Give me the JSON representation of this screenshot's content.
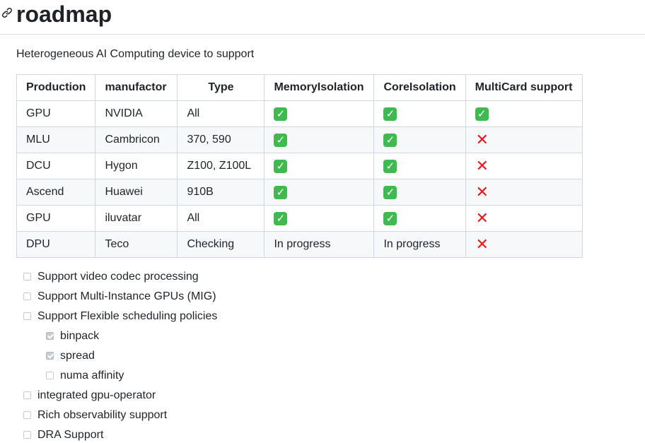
{
  "heading": {
    "title": "roadmap",
    "anchor_icon": "link-icon"
  },
  "intro": "Heterogeneous AI Computing device to support",
  "table": {
    "headers": [
      "Production",
      "manufactor",
      "Type",
      "MemoryIsolation",
      "CoreIsolation",
      "MultiCard support"
    ],
    "rows": [
      [
        "GPU",
        "NVIDIA",
        "All",
        "✅",
        "✅",
        "✅"
      ],
      [
        "MLU",
        "Cambricon",
        "370, 590",
        "✅",
        "✅",
        "❌"
      ],
      [
        "DCU",
        "Hygon",
        "Z100, Z100L",
        "✅",
        "✅",
        "❌"
      ],
      [
        "Ascend",
        "Huawei",
        "910B",
        "✅",
        "✅",
        "❌"
      ],
      [
        "GPU",
        "iluvatar",
        "All",
        "✅",
        "✅",
        "❌"
      ],
      [
        "DPU",
        "Teco",
        "Checking",
        "In progress",
        "In progress",
        "❌"
      ]
    ],
    "colors": {
      "check": "#3fb950",
      "cross": "#e5191c",
      "border": "#d0d7de",
      "alt_row": "#f6f8fa"
    }
  },
  "tasks": [
    {
      "label": "Support video codec processing",
      "checked": false
    },
    {
      "label": "Support Multi-Instance GPUs (MIG)",
      "checked": false
    },
    {
      "label": "Support Flexible scheduling policies",
      "checked": false,
      "subtasks": [
        {
          "label": "binpack",
          "checked": true
        },
        {
          "label": "spread",
          "checked": true
        },
        {
          "label": "numa affinity",
          "checked": false
        }
      ]
    },
    {
      "label": "integrated gpu-operator",
      "checked": false
    },
    {
      "label": "Rich observability support",
      "checked": false
    },
    {
      "label": "DRA Support",
      "checked": false
    }
  ]
}
